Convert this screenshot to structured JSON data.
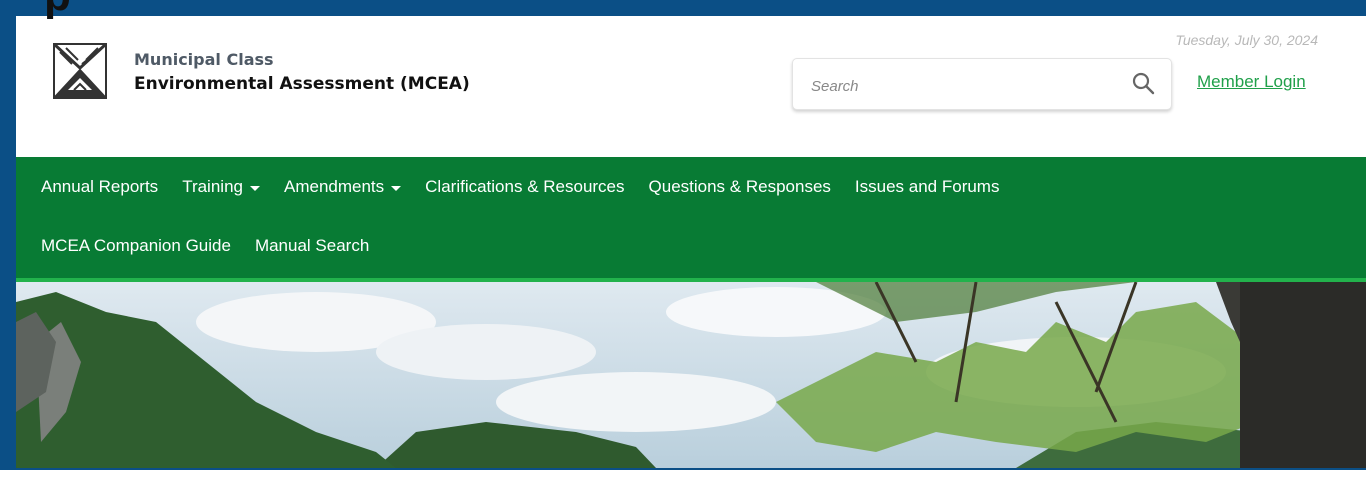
{
  "header": {
    "page_heading_fragment": "p",
    "org_line1": "Municipal Class",
    "org_line2": "Environmental Assessment (MCEA)",
    "date": "Tuesday, July 30, 2024",
    "search": {
      "placeholder": "Search"
    },
    "member_login": "Member Login"
  },
  "nav": {
    "row1": [
      {
        "label": "Annual Reports"
      },
      {
        "label": "Training"
      },
      {
        "label": "Amendments"
      },
      {
        "label": "Clarifications & Resources"
      },
      {
        "label": "Questions & Responses"
      },
      {
        "label": "Issues and Forums"
      }
    ],
    "row2": [
      {
        "label": "MCEA Companion Guide"
      },
      {
        "label": "Manual Search"
      }
    ]
  },
  "colors": {
    "frame_border": "#0b4f86",
    "nav_background": "#087b34",
    "nav_underline": "#22b24c",
    "login_link": "#20a04a"
  },
  "icons": {
    "search": "magnifier-icon",
    "logo": "mcea-logo-icon",
    "dropdown": "caret-down-icon"
  }
}
